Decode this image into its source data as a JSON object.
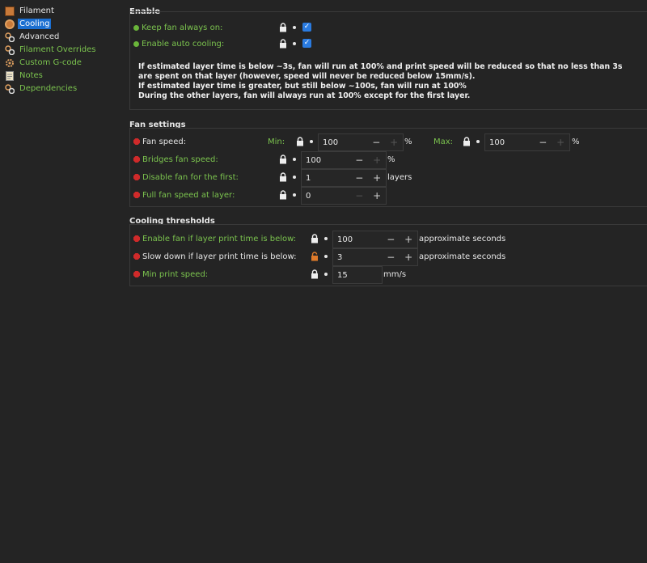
{
  "sidebar": {
    "items": [
      {
        "label": "Filament",
        "icon": "spool-icon",
        "color": "white"
      },
      {
        "label": "Cooling",
        "icon": "fan-icon",
        "color": "white",
        "selected": true
      },
      {
        "label": "Advanced",
        "icon": "gears-icon",
        "color": "white"
      },
      {
        "label": "Filament Overrides",
        "icon": "gears-icon",
        "color": "green"
      },
      {
        "label": "Custom G-code",
        "icon": "cog-icon",
        "color": "green"
      },
      {
        "label": "Notes",
        "icon": "notes-icon",
        "color": "green"
      },
      {
        "label": "Dependencies",
        "icon": "gears-icon",
        "color": "green"
      }
    ]
  },
  "enable": {
    "title": "Enable",
    "keep_fan_label": "Keep fan always on:",
    "auto_cooling_label": "Enable auto cooling:",
    "note_lines": [
      "If estimated layer time is below ~3s, fan will run at 100% and print speed will be reduced so that no less than 3s",
      "are spent on that layer (however, speed will never be reduced below 15mm/s).",
      "If estimated layer time is greater, but still below ~100s, fan will run at 100%",
      "During the other layers, fan will always run at 100% except for the first layer."
    ]
  },
  "fan_settings": {
    "title": "Fan settings",
    "fan_speed_label": "Fan speed:",
    "min_label": "Min:",
    "min_value": "100",
    "max_label": "Max:",
    "max_value": "100",
    "percent": "%",
    "bridges_label": "Bridges fan speed:",
    "bridges_value": "100",
    "disable_label": "Disable fan for the first:",
    "disable_value": "1",
    "layers_unit": "layers",
    "full_label": "Full fan speed at layer:",
    "full_value": "0"
  },
  "thresholds": {
    "title": "Cooling thresholds",
    "enable_fan_label": "Enable fan if layer print time is below:",
    "enable_fan_value": "100",
    "slow_label": "Slow down if layer print time is below:",
    "slow_value": "3",
    "seconds_unit": "approximate seconds",
    "min_speed_label": "Min print speed:",
    "min_speed_value": "15",
    "mms_unit": "mm/s"
  },
  "controls": {
    "minus": "−",
    "plus": "+",
    "check": "✓"
  },
  "colors": {
    "accent": "#1b6fd1",
    "green": "#7bc34e",
    "red": "#d02a2a",
    "orange": "#e07b2a"
  }
}
